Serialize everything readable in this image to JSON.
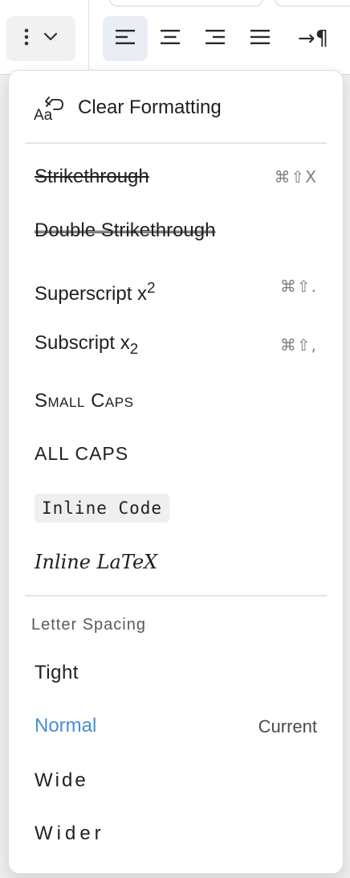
{
  "toolbar": {
    "more_icon": "vertical-ellipsis-icon",
    "chevron_icon": "chevron-down-icon",
    "align_buttons": [
      {
        "name": "align-left",
        "icon": "align-left-icon",
        "active": true
      },
      {
        "name": "align-center",
        "icon": "align-center-icon",
        "active": false
      },
      {
        "name": "align-right",
        "icon": "align-right-icon",
        "active": false
      },
      {
        "name": "align-justify",
        "icon": "align-justify-icon",
        "active": false
      }
    ],
    "paragraph_icon": "→¶"
  },
  "menu": {
    "clear_formatting": {
      "label": "Clear Formatting",
      "icon": "clear-formatting-icon"
    },
    "strikethrough": {
      "label": "Strikethrough",
      "shortcut": "⌘⇧X"
    },
    "double_strikethrough": {
      "label": "Double Strikethrough"
    },
    "superscript": {
      "label": "Superscript x",
      "script": "2",
      "shortcut": "⌘⇧."
    },
    "subscript": {
      "label": "Subscript x",
      "script": "2",
      "shortcut": "⌘⇧,"
    },
    "small_caps": {
      "label": "Small Caps"
    },
    "all_caps": {
      "label": "ALL CAPS"
    },
    "inline_code": {
      "label": "Inline Code"
    },
    "inline_latex": {
      "label": "Inline LaTeX"
    },
    "letter_spacing": {
      "heading": "Letter Spacing",
      "options": [
        {
          "label": "Tight"
        },
        {
          "label": "Normal",
          "status": "Current"
        },
        {
          "label": "Wide"
        },
        {
          "label": "Wider"
        }
      ]
    }
  },
  "colors": {
    "accent": "#4a8ed2",
    "active_button_bg": "#e9eef4",
    "code_chip_bg": "#efefef"
  }
}
